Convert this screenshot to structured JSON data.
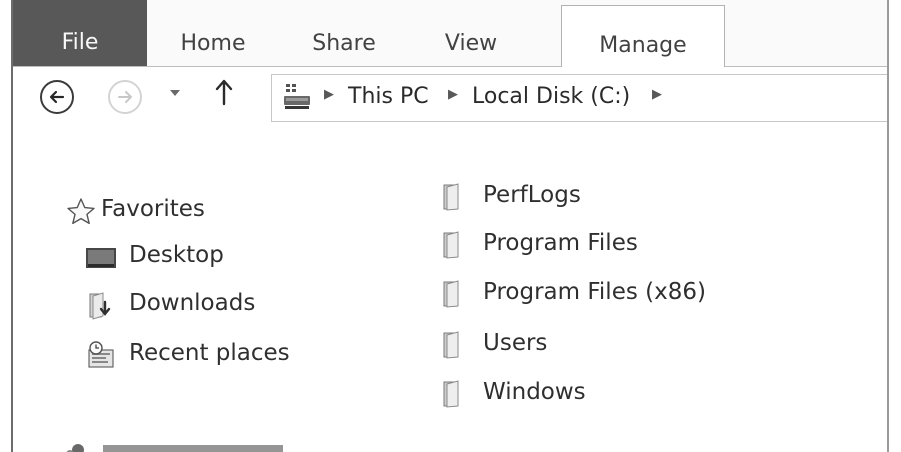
{
  "ribbon": {
    "tabs": [
      {
        "label": "File",
        "icon": "file-tab"
      },
      {
        "label": "Home"
      },
      {
        "label": "Share"
      },
      {
        "label": "View"
      },
      {
        "label": "Manage"
      }
    ]
  },
  "navigation": {
    "back_icon": "back-arrow-icon",
    "forward_icon": "forward-arrow-icon",
    "recent_icon": "chevron-down-icon",
    "up_icon": "up-arrow-icon"
  },
  "address_bar": {
    "root_icon": "computer-icon",
    "crumbs": [
      "This PC",
      "Local Disk (C:)"
    ]
  },
  "nav_pane": {
    "favorites_label": "Favorites",
    "items": [
      {
        "label": "Desktop",
        "icon": "desktop-icon"
      },
      {
        "label": "Downloads",
        "icon": "downloads-folder-icon"
      },
      {
        "label": "Recent places",
        "icon": "recent-places-icon"
      }
    ]
  },
  "content": {
    "folders": [
      {
        "name": "PerfLogs"
      },
      {
        "name": "Program Files"
      },
      {
        "name": "Program Files (x86)"
      },
      {
        "name": "Users"
      },
      {
        "name": "Windows"
      }
    ]
  },
  "colors": {
    "file_tab_bg": "#5a5a5a",
    "file_tab_text": "#f2f2f2",
    "text": "#333333"
  }
}
